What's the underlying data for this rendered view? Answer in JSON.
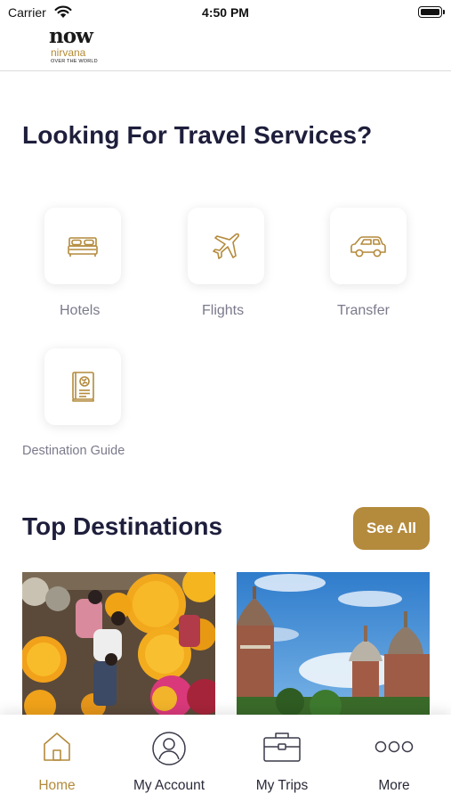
{
  "status_bar": {
    "carrier": "Carrier",
    "time": "4:50 PM"
  },
  "header": {
    "logo": {
      "main": "now",
      "sub": "nirvana",
      "tagline": "OVER THE WORLD"
    }
  },
  "services": {
    "title": "Looking For Travel Services?",
    "items": [
      {
        "label": "Hotels",
        "icon": "bed-icon"
      },
      {
        "label": "Flights",
        "icon": "airplane-icon"
      },
      {
        "label": "Transfer",
        "icon": "car-icon"
      },
      {
        "label": "Destination Guide",
        "icon": "guide-book-icon"
      }
    ]
  },
  "destinations": {
    "title": "Top Destinations",
    "see_all_label": "See All"
  },
  "tab_bar": {
    "items": [
      {
        "label": "Home",
        "icon": "home-icon",
        "active": true
      },
      {
        "label": "My Account",
        "icon": "user-icon",
        "active": false
      },
      {
        "label": "My Trips",
        "icon": "briefcase-icon",
        "active": false
      },
      {
        "label": "More",
        "icon": "more-icon",
        "active": false
      }
    ]
  },
  "colors": {
    "accent": "#b48a3c",
    "heading": "#1e1e3c",
    "label": "#7a7a8c"
  }
}
